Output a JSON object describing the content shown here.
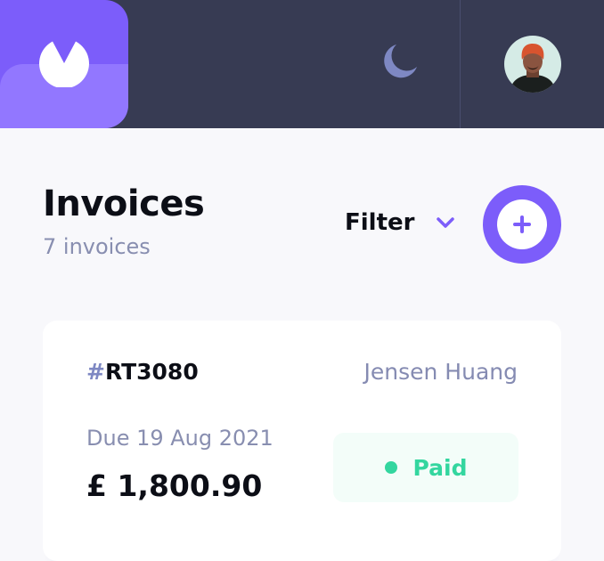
{
  "header": {
    "logo_icon": "app-logo-icon",
    "theme_icon": "moon-icon",
    "avatar_icon": "user-avatar"
  },
  "page": {
    "title": "Invoices",
    "count_label": "7 invoices"
  },
  "filter": {
    "label": "Filter",
    "icon": "chevron-down-icon"
  },
  "new_invoice": {
    "icon": "plus-icon"
  },
  "invoices": [
    {
      "id_prefix": "#",
      "id": "RT3080",
      "client": "Jensen Huang",
      "due": "Due 19 Aug 2021",
      "amount": "£ 1,800.90",
      "status": "Paid",
      "status_color": "#33d69f"
    }
  ],
  "colors": {
    "header_bg": "#373b53",
    "accent": "#7c5dfa",
    "accent_light": "#9277ff",
    "page_bg": "#f8f8fb",
    "paid_bg": "#f3fdf9"
  }
}
